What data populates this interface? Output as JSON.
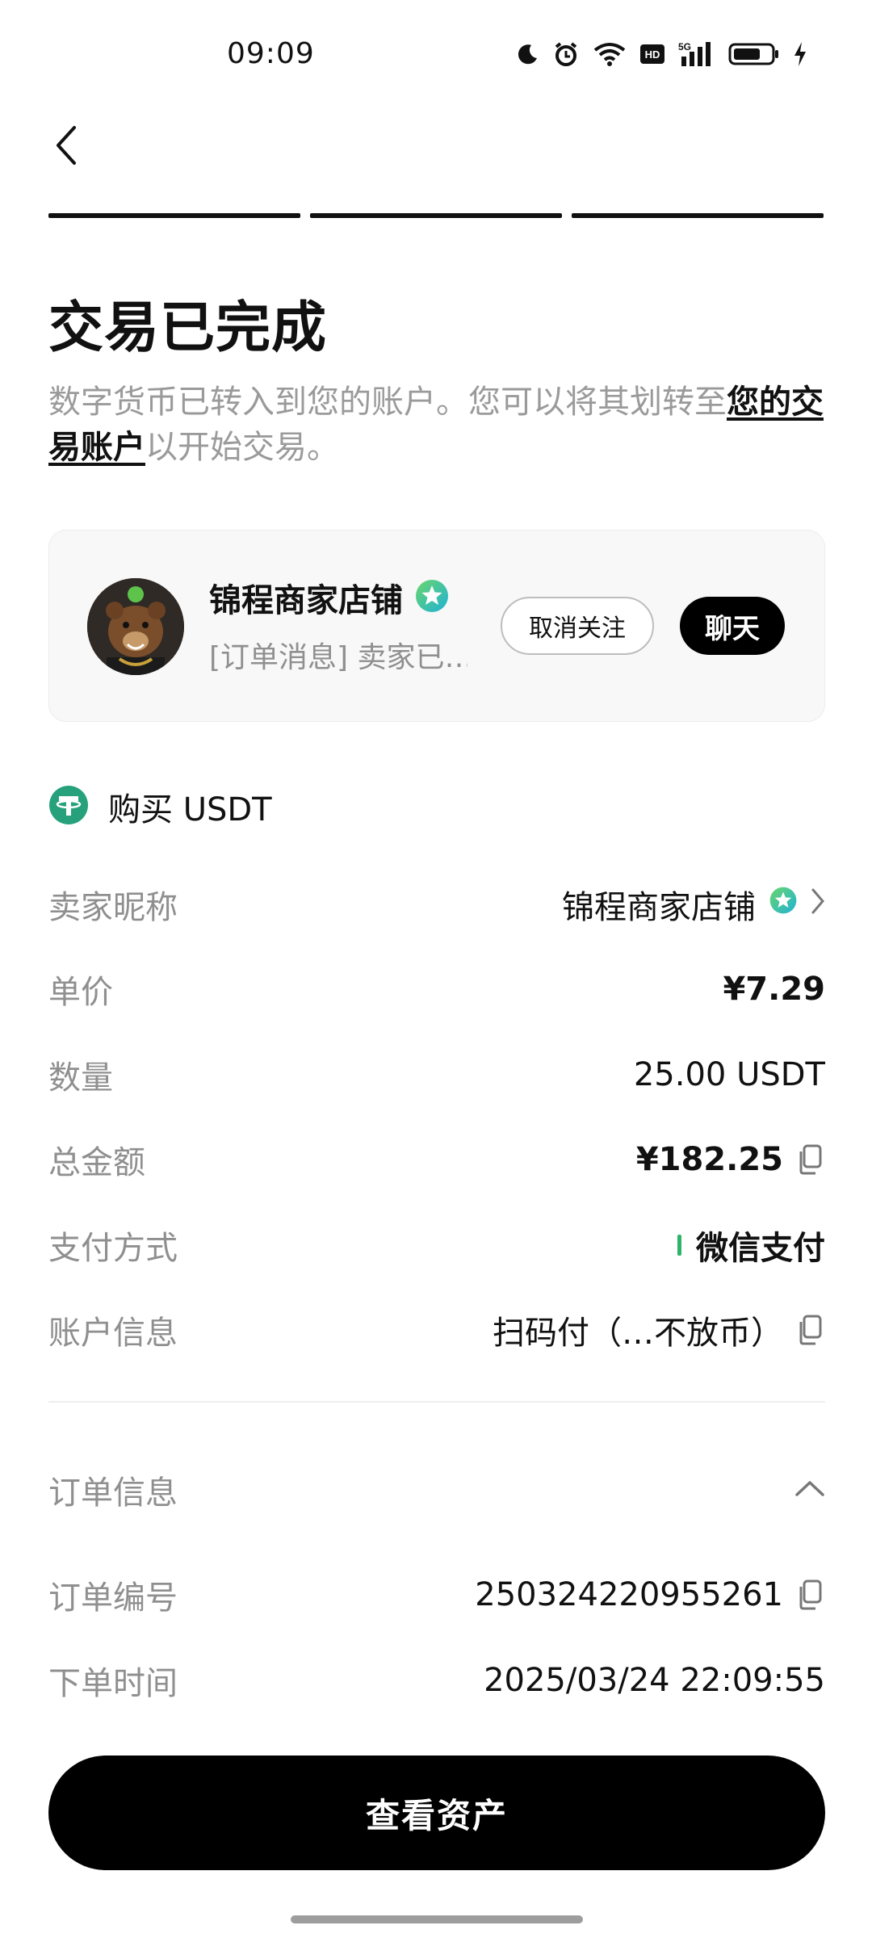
{
  "status_bar": {
    "time": "09:09",
    "icons": [
      "moon-icon",
      "alarm-icon",
      "wifi-icon",
      "hd-icon",
      "signal-5g-icon",
      "battery-icon",
      "charging-icon"
    ]
  },
  "progress": {
    "steps_total": 3,
    "steps_done": 3
  },
  "page": {
    "title": "交易已完成",
    "desc_prefix": "数字货币已转入到您的账户。您可以将其划转至",
    "desc_link": "您的交易账户",
    "desc_suffix": "以开始交易。"
  },
  "merchant": {
    "name": "锦程商家店铺",
    "message": "[订单消息] 卖家已…",
    "unfollow_label": "取消关注",
    "chat_label": "聊天"
  },
  "order": {
    "buy_title": "购买 USDT",
    "rows": [
      {
        "label": "卖家昵称",
        "value": "锦程商家店铺"
      },
      {
        "label": "单价",
        "value": "¥7.29"
      },
      {
        "label": "数量",
        "value": "25.00 USDT"
      },
      {
        "label": "总金额",
        "value": "¥182.25"
      },
      {
        "label": "支付方式",
        "value": "微信支付"
      },
      {
        "label": "账户信息",
        "value": "扫码付（…不放币）"
      }
    ]
  },
  "order_info": {
    "title": "订单信息",
    "rows": [
      {
        "label": "订单编号",
        "value": "250324220955261"
      },
      {
        "label": "下单时间",
        "value": "2025/03/24 22:09:55"
      }
    ]
  },
  "footer": {
    "button_label": "查看资产"
  },
  "colors": {
    "accent": "#000000",
    "label_gray": "#8f8f8f",
    "usdt_green": "#26a17b",
    "wechat_green": "#2fb36b",
    "verified_teal": "#2bc0c8"
  }
}
